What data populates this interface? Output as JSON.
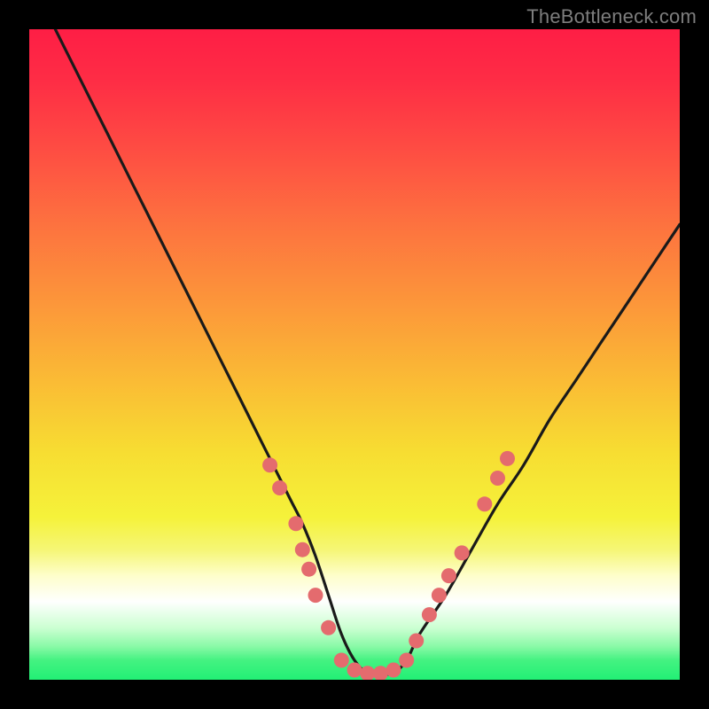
{
  "watermark": "TheBottleneck.com",
  "chart_data": {
    "type": "line",
    "title": "",
    "xlabel": "",
    "ylabel": "",
    "xlim": [
      0,
      100
    ],
    "ylim": [
      0,
      100
    ],
    "grid": false,
    "legend": false,
    "series": [
      {
        "name": "bottleneck-curve",
        "x": [
          4,
          8,
          12,
          16,
          20,
          24,
          28,
          32,
          36,
          40,
          42,
          44,
          46,
          48,
          50,
          52,
          54,
          56,
          58,
          60,
          64,
          68,
          72,
          76,
          80,
          84,
          88,
          92,
          96,
          100
        ],
        "y": [
          100,
          92,
          84,
          76,
          68,
          60,
          52,
          44,
          36,
          28,
          24,
          19,
          13,
          7,
          3,
          1,
          1,
          1,
          3,
          7,
          13,
          20,
          27,
          33,
          40,
          46,
          52,
          58,
          64,
          70
        ]
      }
    ],
    "markers": {
      "name": "highlighted-points",
      "points": [
        {
          "x": 37,
          "y": 33
        },
        {
          "x": 38.5,
          "y": 29.5
        },
        {
          "x": 41,
          "y": 24
        },
        {
          "x": 42,
          "y": 20
        },
        {
          "x": 43,
          "y": 17
        },
        {
          "x": 44,
          "y": 13
        },
        {
          "x": 46,
          "y": 8
        },
        {
          "x": 48,
          "y": 3
        },
        {
          "x": 50,
          "y": 1.5
        },
        {
          "x": 52,
          "y": 1
        },
        {
          "x": 54,
          "y": 1
        },
        {
          "x": 56,
          "y": 1.5
        },
        {
          "x": 58,
          "y": 3
        },
        {
          "x": 59.5,
          "y": 6
        },
        {
          "x": 61.5,
          "y": 10
        },
        {
          "x": 63,
          "y": 13
        },
        {
          "x": 64.5,
          "y": 16
        },
        {
          "x": 66.5,
          "y": 19.5
        },
        {
          "x": 70,
          "y": 27
        },
        {
          "x": 72,
          "y": 31
        },
        {
          "x": 73.5,
          "y": 34
        }
      ]
    },
    "gradient_stops": [
      {
        "pos": 0,
        "color": "#fe1e45"
      },
      {
        "pos": 30,
        "color": "#fd723f"
      },
      {
        "pos": 54,
        "color": "#fabb35"
      },
      {
        "pos": 75,
        "color": "#f5f23a"
      },
      {
        "pos": 88,
        "color": "#fefffe"
      },
      {
        "pos": 100,
        "color": "#22f075"
      }
    ]
  }
}
